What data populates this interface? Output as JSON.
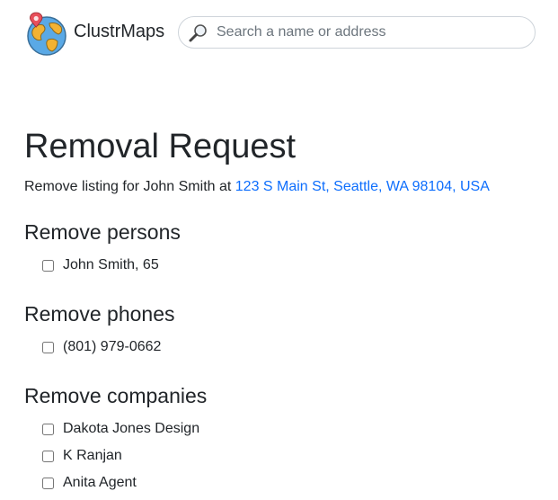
{
  "header": {
    "brand": "ClustrMaps",
    "search": {
      "placeholder": "Search a name or address",
      "value": ""
    }
  },
  "page": {
    "title": "Removal Request",
    "subtitle_prefix": "Remove listing for John Smith at ",
    "address_link": "123 S Main St, Seattle, WA 98104, USA"
  },
  "sections": {
    "persons": {
      "heading": "Remove persons",
      "items": [
        {
          "label": "John Smith, 65",
          "checked": false
        }
      ]
    },
    "phones": {
      "heading": "Remove phones",
      "items": [
        {
          "label": "(801) 979-0662",
          "checked": false
        }
      ]
    },
    "companies": {
      "heading": "Remove companies",
      "items": [
        {
          "label": "Dakota Jones Design",
          "checked": false
        },
        {
          "label": "K Ranjan",
          "checked": false
        },
        {
          "label": "Anita Agent",
          "checked": false
        }
      ]
    }
  },
  "icons": {
    "logo": "globe-pin-icon",
    "search": "magnifier-icon"
  },
  "colors": {
    "link": "#0d6efd",
    "text": "#212529",
    "globe_ocean": "#5aa9e6",
    "globe_land": "#f2b233",
    "pin": "#e8505b"
  }
}
